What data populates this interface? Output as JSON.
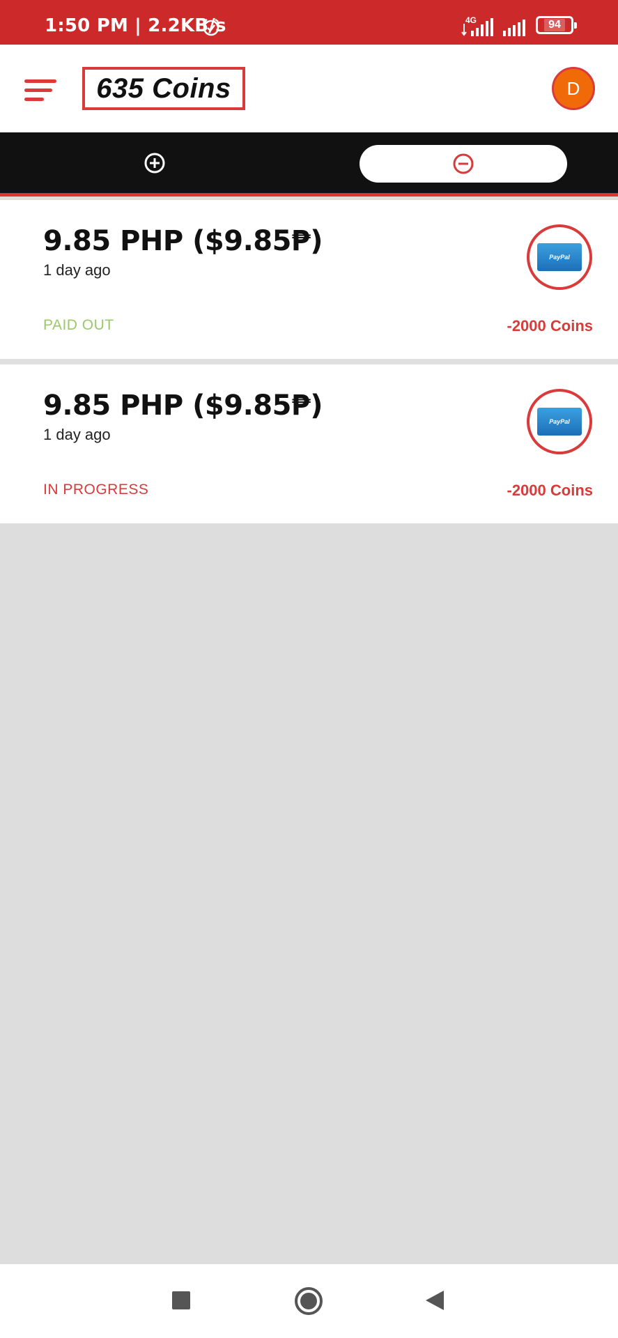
{
  "status_bar": {
    "time": "1:50 PM | 2.2KB/s",
    "network": "4G",
    "battery": "94"
  },
  "header": {
    "coins": "635 Coins",
    "avatar_initial": "D"
  },
  "transactions": [
    {
      "amount": "9.85 PHP ($9.85₱)",
      "time": "1 day ago",
      "status": "PAID OUT",
      "status_color": "#9ac86a",
      "coins": "-2000 Coins",
      "method": "PayPal"
    },
    {
      "amount": "9.85 PHP ($9.85₱)",
      "time": "1 day ago",
      "status": "IN PROGRESS",
      "status_color": "#d93a3a",
      "coins": "-2000 Coins",
      "method": "PayPal"
    }
  ],
  "colors": {
    "accent": "#d93a3a",
    "status_bar": "#cc2a2a",
    "tab_bar": "#111111",
    "background": "#dddddd"
  }
}
